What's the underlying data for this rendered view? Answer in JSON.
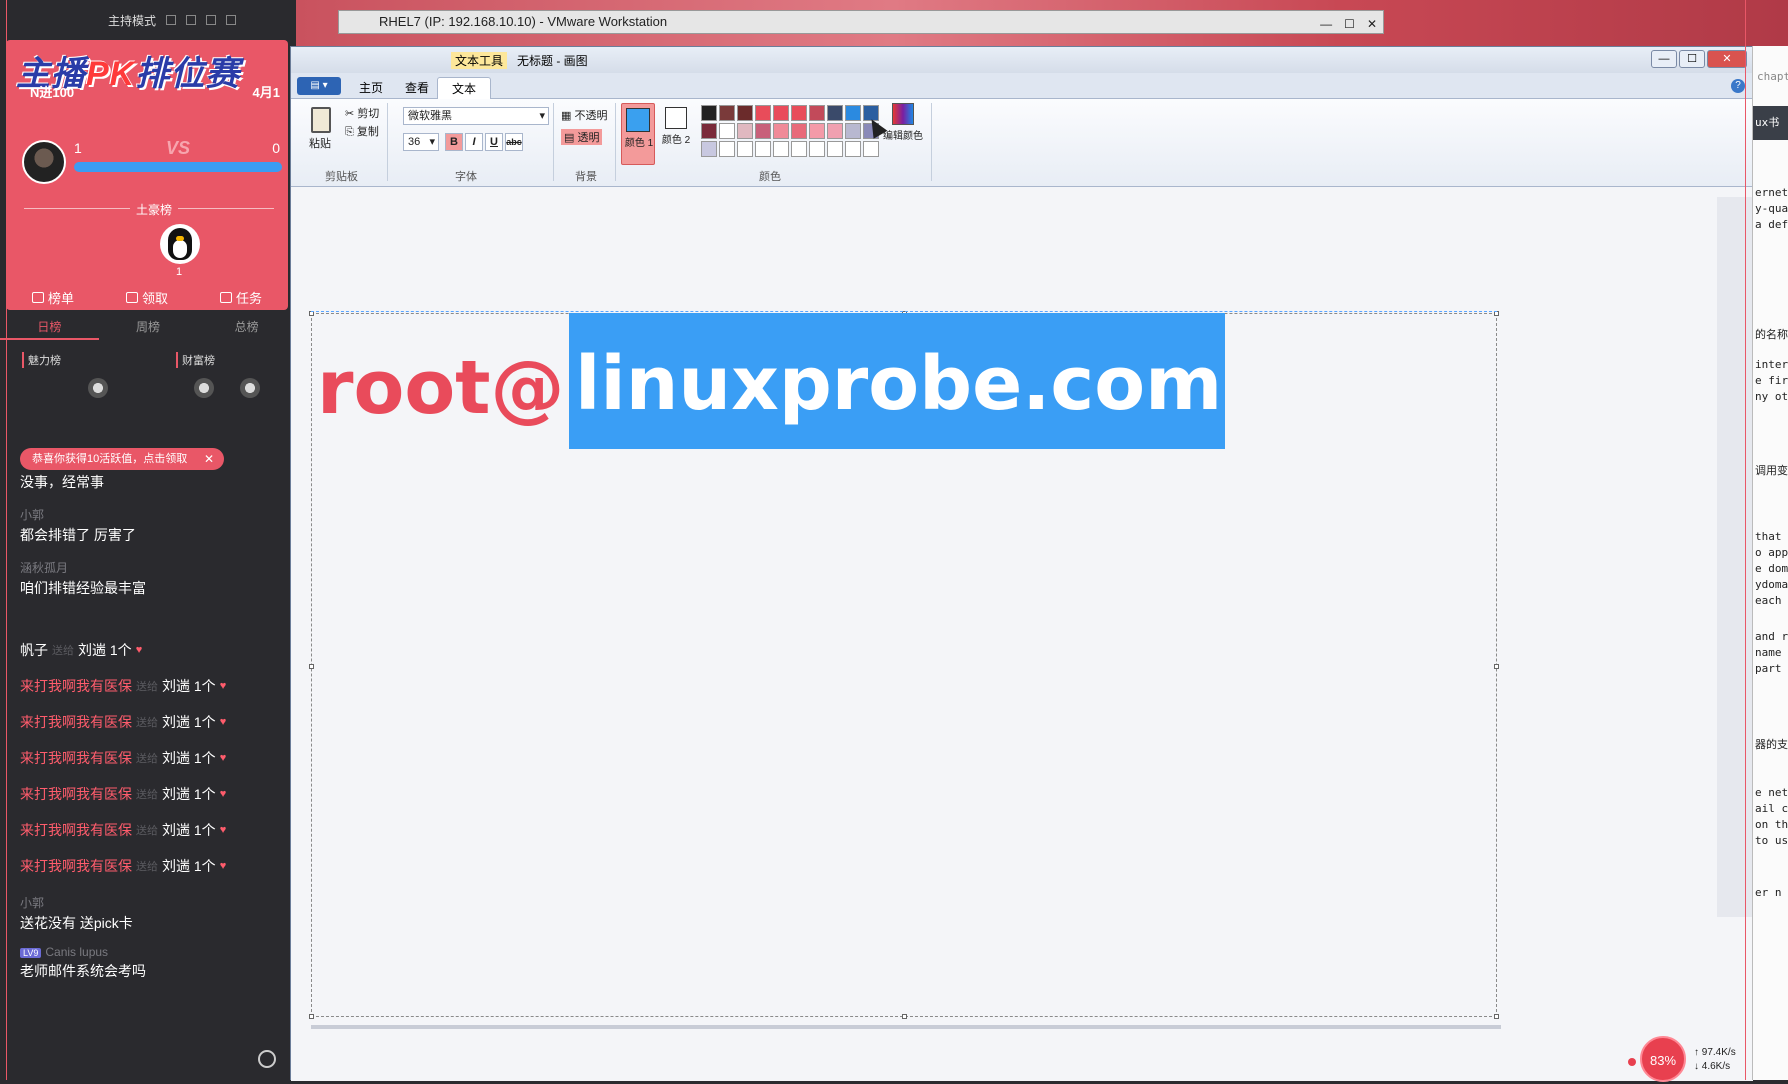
{
  "stream": {
    "mode": "主持模式",
    "banner_title_a": "主播",
    "banner_title_pk": "PK",
    "banner_title_b": "排位赛",
    "subtitle": "N进100",
    "date": "4月1",
    "vs": "VS",
    "left_score": "1",
    "right_score": "0",
    "master_label": "土豪榜",
    "penguin_count": "1",
    "tabs": [
      "榜单",
      "领取",
      "任务"
    ],
    "rank_tabs": [
      "日榜",
      "周榜",
      "总榜"
    ],
    "charm_label": "魅力榜",
    "wealth_label": "财富榜",
    "notify": "恭喜你获得10活跃值，点击领取",
    "messages": [
      {
        "user": "",
        "text": "没事，经常事"
      },
      {
        "user": "小郭",
        "text": "都会排错了 厉害了"
      },
      {
        "user": "涵秋孤月",
        "text": "咱们排错经验最丰富"
      },
      {
        "user": "",
        "text": ""
      }
    ],
    "gift_first": {
      "user": "帆子",
      "faint": "送给",
      "recv": "刘遄 1个"
    },
    "gifts": [
      {
        "user": "来打我啊我有医保",
        "faint": "送给",
        "recv": "刘遄 1个"
      },
      {
        "user": "来打我啊我有医保",
        "faint": "送给",
        "recv": "刘遄 1个"
      },
      {
        "user": "来打我啊我有医保",
        "faint": "送给",
        "recv": "刘遄 1个"
      },
      {
        "user": "来打我啊我有医保",
        "faint": "送给",
        "recv": "刘遄 1个"
      },
      {
        "user": "来打我啊我有医保",
        "faint": "送给",
        "recv": "刘遄 1个"
      },
      {
        "user": "来打我啊我有医保",
        "faint": "送给",
        "recv": "刘遄 1个"
      }
    ],
    "tail_messages": [
      {
        "user": "小郭",
        "text": "送花没有 送pick卡"
      },
      {
        "user": "Canis lupus",
        "level": "LV9",
        "text": "老师邮件系统会考吗"
      }
    ]
  },
  "vmware": {
    "title": "RHEL7 (IP: 192.168.10.10) - VMware Workstation"
  },
  "paint": {
    "context_tab": "文本工具",
    "doc_title": "无标题 - 画图",
    "tabs": [
      "主页",
      "查看",
      "文本"
    ],
    "clipboard": {
      "paste": "粘贴",
      "cut": "剪切",
      "copy": "复制",
      "label": "剪贴板"
    },
    "font": {
      "family": "微软雅黑",
      "size": "36",
      "label": "字体"
    },
    "background": {
      "opaque": "不透明",
      "transparent": "透明",
      "label": "背景"
    },
    "colors": {
      "color1": "颜色 1",
      "color2": "颜色 2",
      "edit": "编辑颜色",
      "label": "颜色",
      "palette": [
        "#222222",
        "#7a3a3a",
        "#6b2b2b",
        "#e84c5a",
        "#e94b5b",
        "#e84c5a",
        "#c24a5a",
        "#3a4a6a",
        "#2b8ae0",
        "#2a5ea0",
        "#7a2a3a",
        "#ffffff",
        "#e0b8c0",
        "#c8607a",
        "#f08a98",
        "#e86a7a",
        "#f49aa8",
        "#f0a0b0",
        "#b8b8d0",
        "#8a8ab8",
        "#c8c8e0"
      ]
    },
    "text_red": "root@",
    "text_highlight": "linuxprobe.com"
  },
  "tray": {
    "percent": "83",
    "up": "97.4K/s",
    "down": "4.6K/s"
  },
  "right_edge": {
    "chapter": "chapt",
    "header": "ux书",
    "lines": [
      "ernet",
      "y-qua",
      "a def",
      "的名称",
      "inter",
      "e firs",
      "ny ot",
      "调用变",
      "that",
      "o app",
      "e doma",
      "ydomai",
      "each u",
      "and r",
      "name",
      "part",
      "器的支",
      "e net",
      "ail c",
      "on th",
      "to use",
      "er n"
    ]
  }
}
